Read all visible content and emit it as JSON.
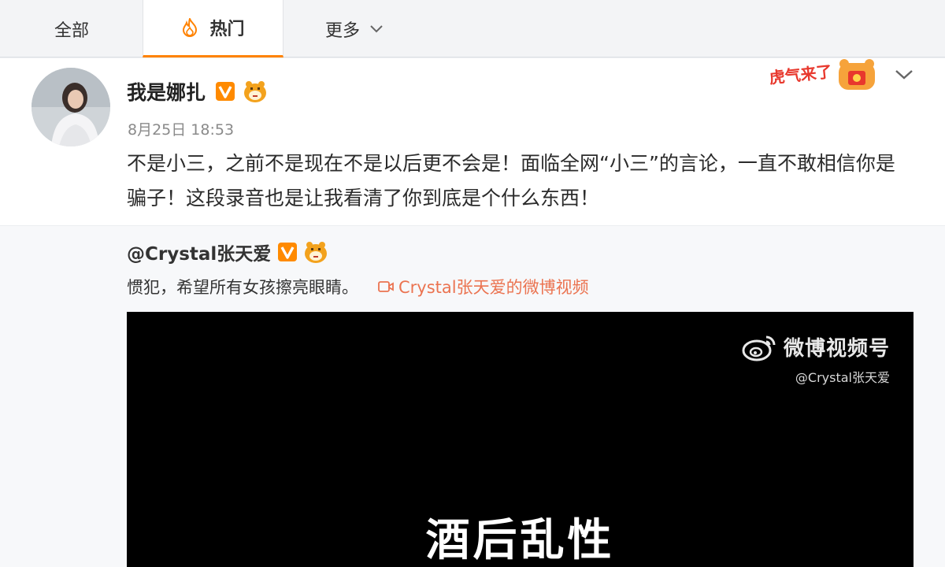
{
  "tabs": [
    {
      "label": "全部"
    },
    {
      "label": "热门",
      "icon": "fire-icon",
      "active": true
    },
    {
      "label": "更多",
      "icon": "chevron-down-icon"
    }
  ],
  "post": {
    "username": "我是娜扎",
    "timestamp": "8月25日 18:53",
    "text": "不是小三，之前不是现在不是以后更不会是！面临全网“小三”的言论，一直不敢相信你是骗子！这段录音也是让我看清了你到底是个什么东西！",
    "stamp_text": "虎气来了"
  },
  "repost": {
    "username": "@Crystal张天爱",
    "text": "惯犯，希望所有女孩擦亮眼睛。",
    "video_link": "Crystal张天爱的微博视频"
  },
  "video": {
    "watermark_title": "微博视频号",
    "watermark_handle": "@Crystal张天爱",
    "subtitle": "酒后乱性"
  },
  "colors": {
    "accent": "#ff8200",
    "link": "#eb7350",
    "verified_badge": "#f5a623"
  }
}
